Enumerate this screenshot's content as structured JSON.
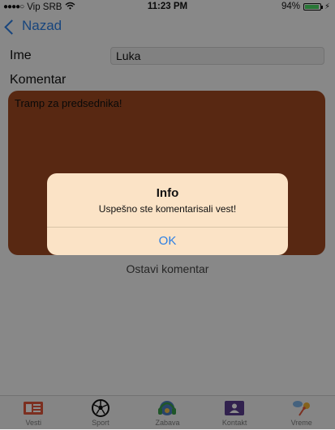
{
  "status": {
    "carrier": "Vip SRB",
    "time": "11:23 PM",
    "battery_percent": "94%",
    "battery_level": 0.94,
    "signal_dots": "●●●●○"
  },
  "nav": {
    "back_label": "Nazad"
  },
  "form": {
    "name_label": "Ime",
    "name_value": "Luka",
    "comment_label": "Komentar",
    "comment_value": "Tramp za predsednika!",
    "submit_label": "Ostavi komentar"
  },
  "alert": {
    "title": "Info",
    "message": "Uspešno ste komentarisali vest!",
    "ok_label": "OK"
  },
  "tabs": [
    {
      "label": "Vesti",
      "icon": "newspaper-icon"
    },
    {
      "label": "Sport",
      "icon": "soccer-ball-icon"
    },
    {
      "label": "Zabava",
      "icon": "headphones-icon"
    },
    {
      "label": "Kontakt",
      "icon": "contact-card-icon"
    },
    {
      "label": "Vreme",
      "icon": "weather-icon"
    }
  ],
  "colors": {
    "accent": "#2c7fe3",
    "comment_bg": "#a04a22",
    "alert_bg": "#fbe3c6",
    "battery": "#4cd964"
  }
}
